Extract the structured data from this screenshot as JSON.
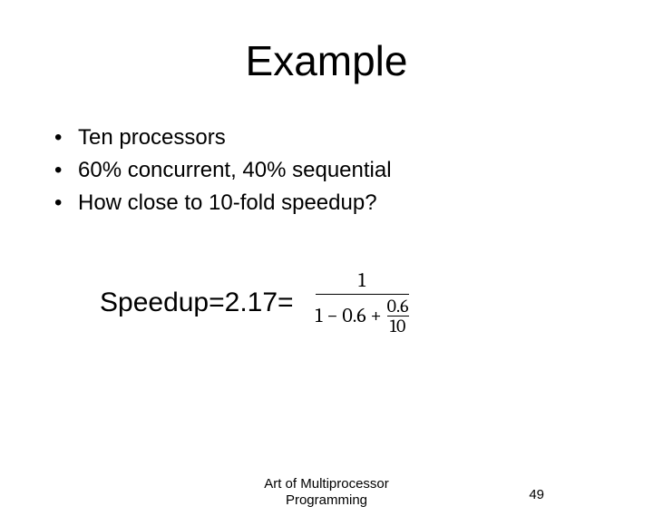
{
  "title": "Example",
  "bullets": {
    "b1": "Ten processors",
    "b2": "60% concurrent, 40% sequential",
    "b3": "How close to 10-fold speedup?"
  },
  "speedup": {
    "label": "Speedup=2.17=",
    "numerator": "1",
    "denom_minus": "1 − 0.6 +",
    "frac_top": "0.6",
    "frac_bottom": "10"
  },
  "footer": {
    "line1": "Art of Multiprocessor",
    "line2": "Programming",
    "page": "49"
  }
}
